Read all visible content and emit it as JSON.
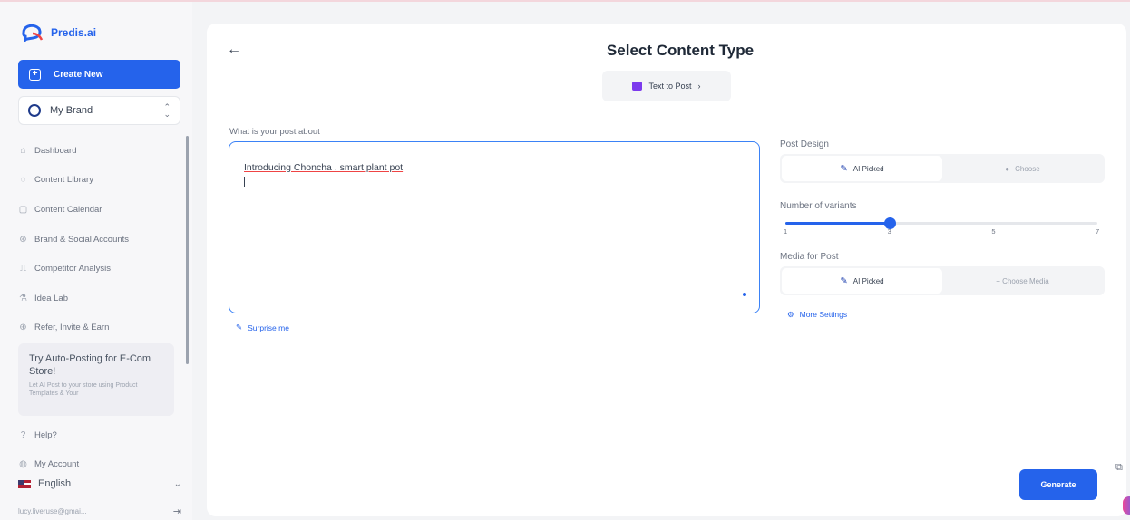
{
  "app": {
    "logo_text": "Predis.ai"
  },
  "sidebar": {
    "create_label": "Create New",
    "brand_name": "My Brand",
    "items": [
      {
        "label": "Dashboard",
        "icon": "home-icon"
      },
      {
        "label": "Content Library",
        "icon": "library-icon"
      },
      {
        "label": "Content Calendar",
        "icon": "calendar-icon"
      },
      {
        "label": "Brand & Social Accounts",
        "icon": "accounts-icon"
      },
      {
        "label": "Competitor Analysis",
        "icon": "analysis-icon"
      },
      {
        "label": "Idea Lab",
        "icon": "idea-icon"
      },
      {
        "label": "Refer, Invite & Earn",
        "icon": "refer-icon"
      }
    ],
    "promo": {
      "title": "Try Auto-Posting for E-Com Store!",
      "text": "Let AI Post to your store using Product Templates & Your"
    },
    "bottom_items": [
      {
        "label": "Help?",
        "icon": "help-icon"
      },
      {
        "label": "My Account",
        "icon": "account-icon"
      }
    ],
    "language": "English",
    "user_email": "lucy.liveruse@gmai..."
  },
  "main": {
    "title": "Select Content Type",
    "content_type": "Text to Post",
    "post_label": "What is your post about",
    "post_text": "Introducing Choncha , smart plant pot",
    "surprise_label": "Surprise me",
    "post_design": {
      "label": "Post Design",
      "options": [
        "AI Picked",
        "Choose"
      ],
      "selected": "AI Picked"
    },
    "variants": {
      "label": "Number of variants",
      "ticks": [
        "1",
        "3",
        "5",
        "7"
      ],
      "min": 1,
      "max": 7,
      "value": 3
    },
    "media": {
      "label": "Media for Post",
      "options": [
        "AI Picked",
        "+  Choose Media"
      ],
      "selected": "AI Picked"
    },
    "more_settings": "More Settings",
    "generate_label": "Generate"
  },
  "colors": {
    "accent": "#2563eb"
  }
}
